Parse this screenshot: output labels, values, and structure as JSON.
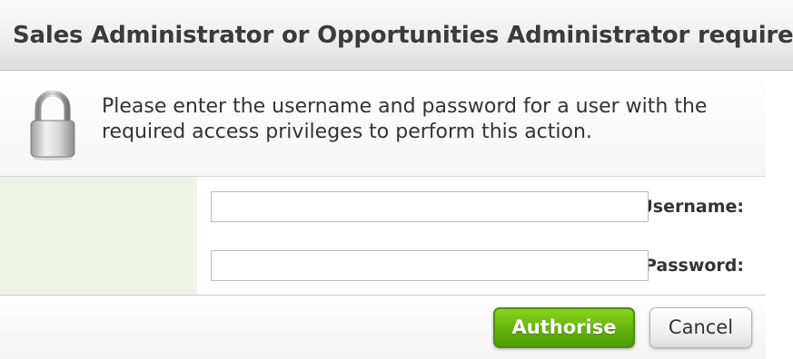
{
  "dialog": {
    "title": "Sales Administrator or Opportunities Administrator required",
    "message": "Please enter the username and password for a user with the required access privileges to perform this action.",
    "lock_icon": "padlock-icon"
  },
  "form": {
    "username_label": "Username:",
    "username_value": "",
    "password_label": "Password:",
    "password_value": ""
  },
  "buttons": {
    "authorise_label": "Authorise",
    "cancel_label": "Cancel"
  },
  "colors": {
    "authorise_green": "#63b20c",
    "label_column_bg": "#eff3e6"
  }
}
